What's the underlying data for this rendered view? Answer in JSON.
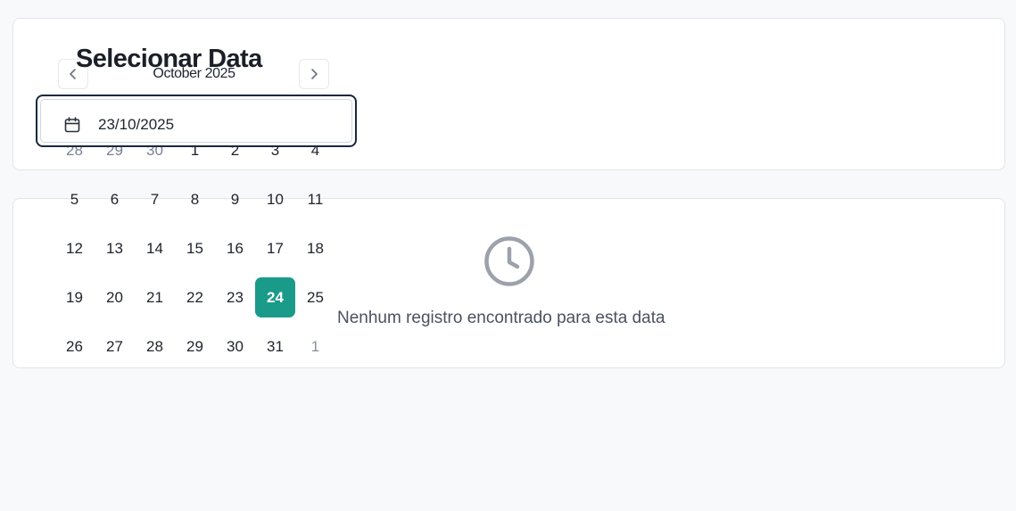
{
  "page": {
    "title": "Selecionar Data"
  },
  "date_input": {
    "value": "23/10/2025",
    "icon": "calendar-icon"
  },
  "calendar": {
    "month_label": "October 2025",
    "prev_icon": "chevron-left-icon",
    "next_icon": "chevron-right-icon",
    "weeks": [
      [
        "28",
        "29",
        "30",
        "1",
        "2",
        "3",
        "4"
      ],
      [
        "5",
        "6",
        "7",
        "8",
        "9",
        "10",
        "11"
      ],
      [
        "12",
        "13",
        "14",
        "15",
        "16",
        "17",
        "18"
      ],
      [
        "19",
        "20",
        "21",
        "22",
        "23",
        "24",
        "25"
      ],
      [
        "26",
        "27",
        "28",
        "29",
        "30",
        "31",
        "1"
      ]
    ],
    "selected_day": "24",
    "accent_color": "#1a9b8a"
  },
  "empty_state": {
    "icon": "clock-icon",
    "message": "Nenhum registro encontrado para esta data"
  }
}
